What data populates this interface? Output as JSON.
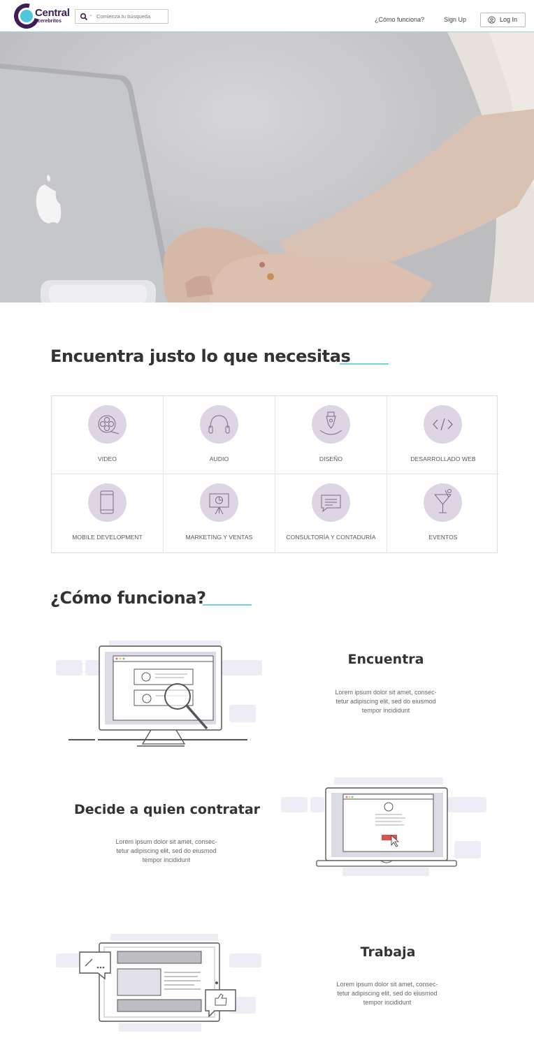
{
  "header": {
    "logo_main": "Central",
    "logo_sub": "cerebritos",
    "search_placeholder": "Comienza tu búsqueda",
    "nav_how": "¿Cómo funciona?",
    "nav_signup": "Sign Up",
    "login": "Log In"
  },
  "categories_section": {
    "title": "Encuentra justo lo que necesitas",
    "items": [
      {
        "label": "VIDEO",
        "icon": "film-reel-icon"
      },
      {
        "label": "AUDIO",
        "icon": "headphones-icon"
      },
      {
        "label": "DISEÑO",
        "icon": "pen-nib-icon"
      },
      {
        "label": "DESARROLLADO WEB",
        "icon": "code-icon"
      },
      {
        "label": "MOBILE DEVELOPMENT",
        "icon": "smartphone-icon"
      },
      {
        "label": "MARKETING Y VENTAS",
        "icon": "presentation-board-icon"
      },
      {
        "label": "CONSULTORÍA Y CONTADURÍA",
        "icon": "chat-document-icon"
      },
      {
        "label": "EVENTOS",
        "icon": "cocktail-glass-icon"
      }
    ]
  },
  "how_section": {
    "title": "¿Cómo funciona?",
    "steps": [
      {
        "title": "Encuentra",
        "text_line1": "Lorem ipsum dolor sit amet, consec-",
        "text_line2": "tetur adipiscing elit, sed do eiusmod",
        "text_line3": "tempor incididunt"
      },
      {
        "title": "Decide a quien contratar",
        "text_line1": "Lorem ipsum dolor sit amet, consec-",
        "text_line2": "tetur adipiscing elit, sed do eiusmod",
        "text_line3": "tempor incididunt"
      },
      {
        "title": "Trabaja",
        "text_line1": "Lorem ipsum dolor sit amet, consec-",
        "text_line2": "tetur adipiscing elit, sed do eiusmod",
        "text_line3": "tempor incididunt"
      }
    ]
  },
  "colors": {
    "brand_purple": "#3d1d55",
    "accent_cyan": "#6fd3e3",
    "icon_circle": "#ddd5e3"
  }
}
